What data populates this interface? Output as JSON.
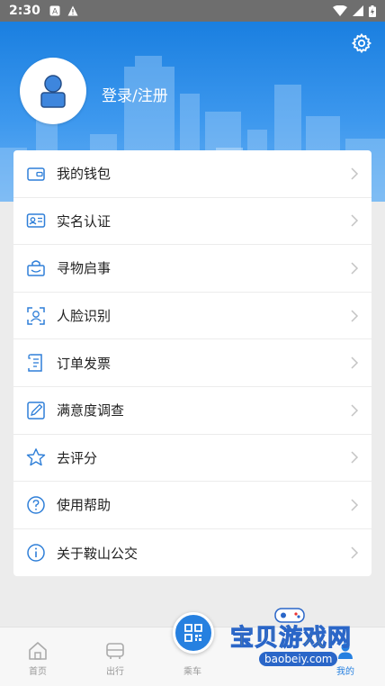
{
  "status": {
    "time": "2:30"
  },
  "header": {
    "login_text": "登录/注册"
  },
  "menu": {
    "items": [
      {
        "label": "我的钱包",
        "icon": "wallet-icon"
      },
      {
        "label": "实名认证",
        "icon": "id-card-icon"
      },
      {
        "label": "寻物启事",
        "icon": "lost-found-icon"
      },
      {
        "label": "人脸识别",
        "icon": "face-scan-icon"
      },
      {
        "label": "订单发票",
        "icon": "invoice-icon"
      },
      {
        "label": "满意度调查",
        "icon": "pencil-icon"
      },
      {
        "label": "去评分",
        "icon": "star-icon"
      },
      {
        "label": "使用帮助",
        "icon": "help-icon"
      },
      {
        "label": "关于鞍山公交",
        "icon": "info-icon"
      }
    ]
  },
  "tabbar": {
    "home": "首页",
    "travel": "出行",
    "ride": "乘车",
    "mine": "我的"
  },
  "watermark": {
    "text": "宝贝游戏网",
    "url": "baobeiy.com"
  },
  "colors": {
    "accent": "#2680e0",
    "header_top": "#1a7fe0",
    "icon_blue": "#2f7fd8"
  }
}
